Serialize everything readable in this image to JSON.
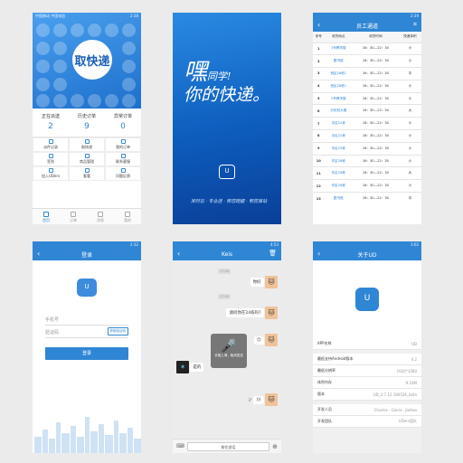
{
  "home": {
    "status_left": "中国移动 中国电信",
    "status_right": "2:38",
    "banner_text": "取快递",
    "stats": [
      {
        "label": "正在派送",
        "value": "2"
      },
      {
        "label": "历史订单",
        "value": "9"
      },
      {
        "label": "异常订单",
        "value": "0"
      }
    ],
    "grid": [
      "派件记录",
      "取快递",
      "我的订单",
      "签到",
      "商品管理",
      "联系客服",
      "我的收入",
      "消息",
      "设置"
    ],
    "grid_bottom": [
      "加入UDers",
      "看看",
      "问题反馈"
    ],
    "tabs": [
      "首页",
      "订单",
      "消息",
      "我的"
    ]
  },
  "splash": {
    "line1": "嘿",
    "line1b": "同学!",
    "line2": "你的快递。",
    "logo": "U",
    "slogan": "准时达 · 专业送 · 帮您跑腿 · 帮您驿站"
  },
  "staff": {
    "status_right": "2:39",
    "title": "员工通道",
    "headers": [
      "序号",
      "收货地点",
      "收货时间",
      "快递体积"
    ],
    "rows": [
      [
        "1",
        "1号教学楼",
        "16：30—22：30",
        "小"
      ],
      [
        "2",
        "图书馆",
        "16：30—22：30",
        "小"
      ],
      [
        "3",
        "西区28栋1",
        "16：30—22：30",
        "中"
      ],
      [
        "4",
        "西区28栋1",
        "16：30—22：30",
        "小"
      ],
      [
        "5",
        "2号教学楼",
        "16：30—22：30",
        "小"
      ],
      [
        "6",
        "分校机大楼",
        "16：30—22：30",
        "大"
      ],
      [
        "7",
        "中区22栋",
        "16：30—22：30",
        "小"
      ],
      [
        "8",
        "中区22栋",
        "16：30—22：30",
        "小"
      ],
      [
        "9",
        "中区22栋",
        "16：30—22：30",
        "小"
      ],
      [
        "10",
        "东区28栋",
        "16：30—22：30",
        "小"
      ],
      [
        "11",
        "东区28栋",
        "16：30—22：30",
        "大"
      ],
      [
        "12",
        "东区28栋",
        "16：30—22：30",
        "小"
      ],
      [
        "13",
        "图书馆",
        "16：30—22：30",
        "中"
      ]
    ]
  },
  "login": {
    "status_right": "2:32",
    "title": "登录",
    "logo": "U",
    "phone_ph": "手机号",
    "code_ph": "验证码",
    "code_btn": "获取验证码",
    "login_btn": "登录"
  },
  "chat": {
    "status_right": "4:53",
    "title": "Keis",
    "time1": "17:00",
    "time2": "17:00",
    "msgs": [
      "你好",
      "请问你在24栋吗?",
      "是的"
    ],
    "voice_len": "3\"",
    "rec_tip": "手指上滑，取消发送",
    "hold_label": "按住说话"
  },
  "about": {
    "status_right": "3:02",
    "title": "关于UD",
    "logo": "U",
    "rows": [
      {
        "k": "APP名称",
        "v": "UD"
      },
      {
        "k": "最低支持Android版本",
        "v": "4.2"
      },
      {
        "k": "最低分辨率",
        "v": "1920*1080"
      },
      {
        "k": "体积内存",
        "v": "9.10M"
      },
      {
        "k": "版本",
        "v": "UD_2.7.12.180526_beta"
      },
      {
        "k": "开发人员",
        "v": "Charles · Gloria · JieHao"
      },
      {
        "k": "开发团队",
        "v": "UDers团队"
      }
    ]
  }
}
